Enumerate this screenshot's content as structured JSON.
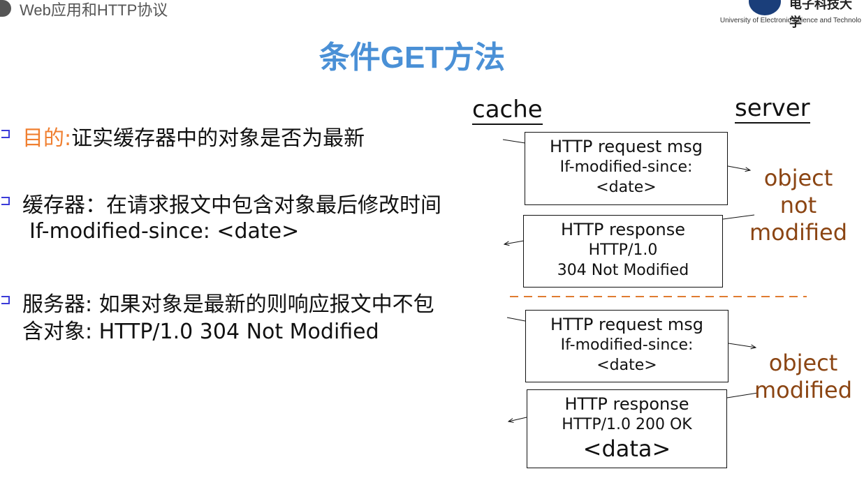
{
  "header": {
    "section": "Web应用和HTTP协议",
    "logo_text": "电子科技大学",
    "logo_subtext": "University of Electronic Science and Technolo"
  },
  "title": "条件GET方法",
  "bullets": [
    {
      "label": "目的:",
      "text": "证实缓存器中的对象是否为最新",
      "label_color": "#f07f30"
    },
    {
      "text": "缓存器：在请求报文中包含对象最后修改时间",
      "text2": "If-modified-since: <date>"
    },
    {
      "text": "服务器: 如果对象是最新的则响应报文中不包",
      "text2": "含对象: HTTP/1.0 304 Not Modified"
    }
  ],
  "diagram": {
    "cache": "cache",
    "server": "server",
    "req1": [
      "HTTP request msg",
      "If-modified-since:",
      "<date>"
    ],
    "resp1": [
      "HTTP response",
      "HTTP/1.0",
      "304 Not Modified"
    ],
    "note1": [
      "object",
      "not",
      "modified"
    ],
    "req2": [
      "HTTP request msg",
      "If-modified-since:",
      "<date>"
    ],
    "resp2": [
      "HTTP response",
      "HTTP/1.0 200 OK",
      "<data>"
    ],
    "note2": [
      "object",
      "modified"
    ],
    "note_color": "#8b4513",
    "divider_color": "#e07b30"
  }
}
